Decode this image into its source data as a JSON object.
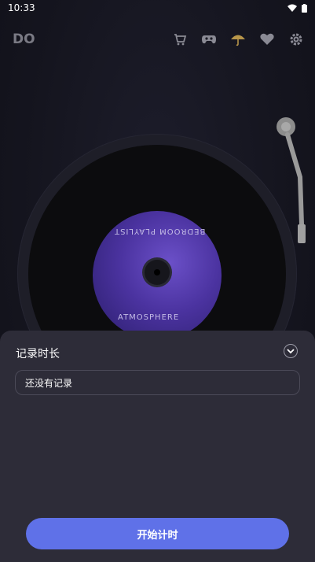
{
  "status": {
    "time": "10:33"
  },
  "app": {
    "logo": "DO"
  },
  "record_label": {
    "top_text": "BEDROOM PLAYLIST",
    "bottom_text": "ATMOSPHERE"
  },
  "sheet": {
    "title": "记录时长",
    "empty_text": "还没有记录",
    "start_button": "开始计时"
  },
  "colors": {
    "accent": "#5f71e8",
    "sheet_bg": "#2d2c38",
    "bg": "#15151f"
  },
  "icons": [
    "cart-icon",
    "gamepad-icon",
    "umbrella-icon",
    "heart-icon",
    "gear-icon"
  ]
}
